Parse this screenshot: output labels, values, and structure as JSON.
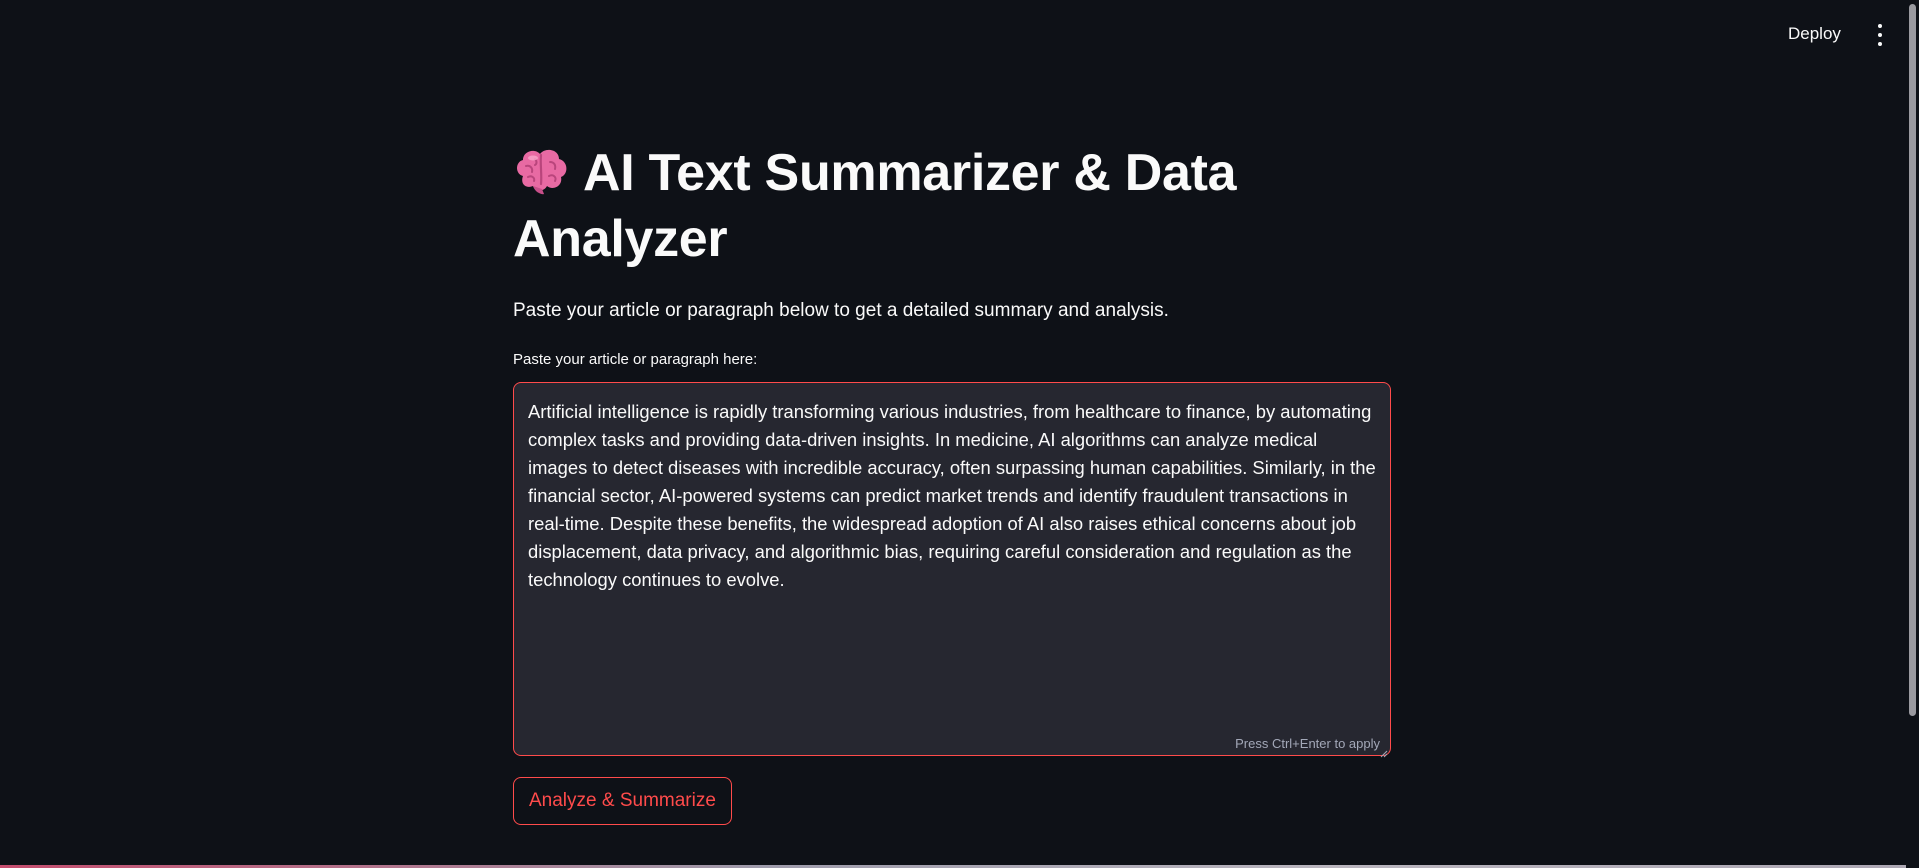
{
  "header": {
    "deploy_label": "Deploy",
    "menu_icon": "more-vertical-icon"
  },
  "main": {
    "title_icon": "brain-icon",
    "title": "AI Text Summarizer & Data Analyzer",
    "subtitle": "Paste your article or paragraph below to get a detailed summary and analysis.",
    "input_label": "Paste your article or paragraph here:",
    "input_value": "Artificial intelligence is rapidly transforming various industries, from healthcare to finance, by automating complex tasks and providing data-driven insights. In medicine, AI algorithms can analyze medical images to detect diseases with incredible accuracy, often surpassing human capabilities. Similarly, in the financial sector, AI-powered systems can predict market trends and identify fraudulent transactions in real-time. Despite these benefits, the widespread adoption of AI also raises ethical concerns about job displacement, data privacy, and algorithmic bias, requiring careful consideration and regulation as the technology continues to evolve.",
    "input_hint": "Press Ctrl+Enter to apply",
    "button_label": "Analyze & Summarize"
  },
  "colors": {
    "background": "#0e1117",
    "input_background": "#262730",
    "accent": "#ff4b4b",
    "text": "#fafafa",
    "hint_text": "#a3a8b8"
  }
}
